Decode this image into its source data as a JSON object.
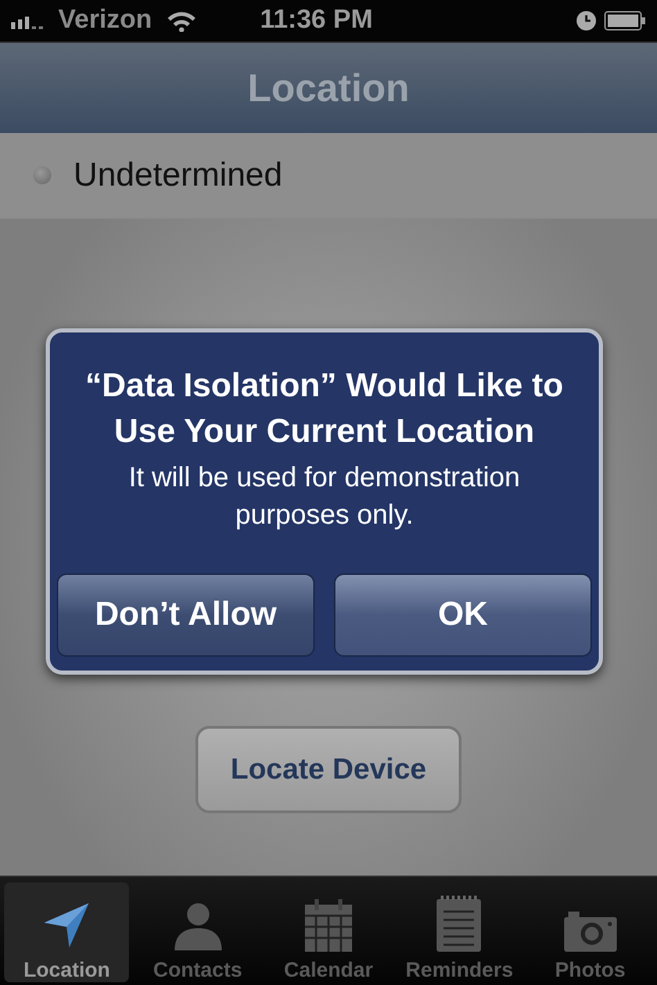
{
  "status_bar": {
    "carrier": "Verizon",
    "time": "11:36 PM"
  },
  "nav_bar": {
    "title": "Location"
  },
  "status_row": {
    "label": "Undetermined"
  },
  "locate_button": "Locate Device",
  "alert": {
    "title": "“Data Isolation” Would Like to Use Your Current Location",
    "message": "It will be used for demonstration purposes only.",
    "buttons": [
      {
        "label": "Don’t Allow",
        "kind": "cancel"
      },
      {
        "label": "OK",
        "kind": "default"
      }
    ]
  },
  "tabs": [
    {
      "label": "Location",
      "kind": "location",
      "selected": true
    },
    {
      "label": "Contacts",
      "kind": "contacts",
      "selected": false
    },
    {
      "label": "Calendar",
      "kind": "calendar",
      "selected": false
    },
    {
      "label": "Reminders",
      "kind": "reminders",
      "selected": false
    },
    {
      "label": "Photos",
      "kind": "photos",
      "selected": false
    }
  ]
}
